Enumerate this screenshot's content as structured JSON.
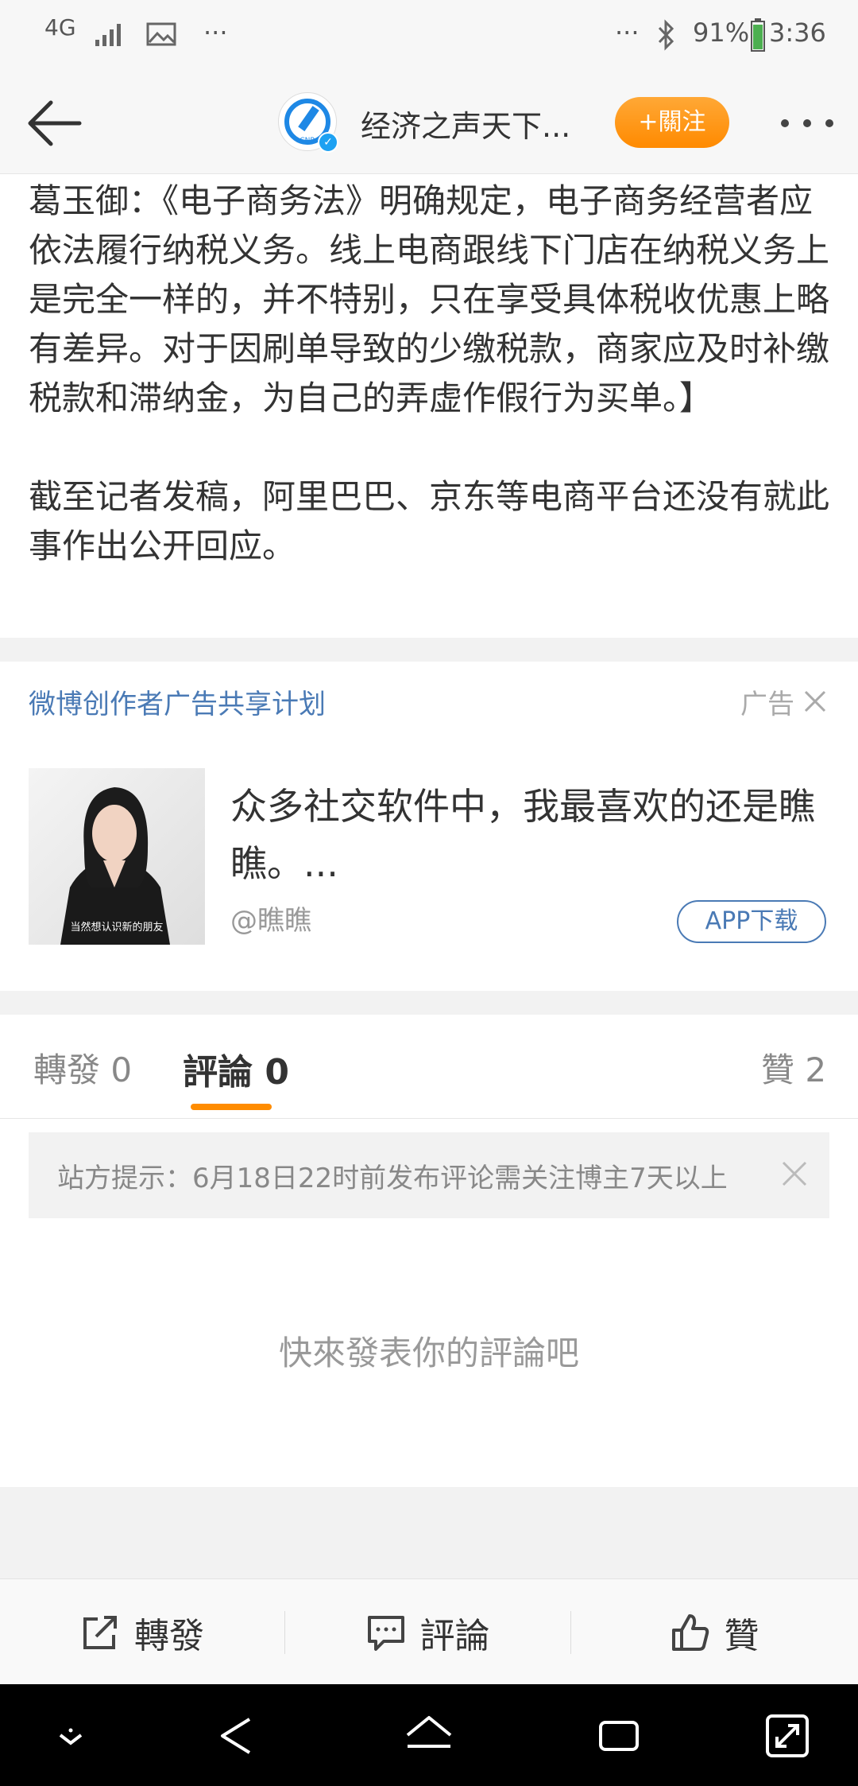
{
  "status_bar": {
    "network": "4G",
    "left_overflow": "···",
    "right_overflow": "···",
    "battery": "91%",
    "time": "3:36"
  },
  "header": {
    "title": "经济之声天下...",
    "follow_label": "+關注"
  },
  "article": {
    "paragraphs": [
      "葛玉御：《电子商务法》明确规定，电子商务经营者应依法履行纳税义务。线上电商跟线下门店在纳税义务上是完全一样的，并不特别，只在享受具体税收优惠上略有差异。对于因刷单导致的少缴税款，商家应及时补缴税款和滞纳金，为自己的弄虚作假行为买单。】",
      "截至记者发稿，阿里巴巴、京东等电商平台还没有就此事作出公开回应。"
    ]
  },
  "ad": {
    "source": "微博创作者广告共享计划",
    "label": "广告",
    "text": "众多社交软件中，我最喜欢的还是瞧瞧。...",
    "handle": "@瞧瞧",
    "button": "APP下载",
    "thumb_caption": "当然想认识新的朋友"
  },
  "tabs": {
    "repost": "轉發 0",
    "comment": "評論 0",
    "like": "贊 2"
  },
  "notice": {
    "text": "站方提示：6月18日22时前发布评论需关注博主7天以上"
  },
  "empty_hint": "快來發表你的評論吧",
  "actions": {
    "repost": "轉發",
    "comment": "評論",
    "like": "贊"
  },
  "colors": {
    "accent": "#ff8c00",
    "link": "#4a7ab5"
  },
  "icons": {
    "status": [
      "signal-icon",
      "image-icon",
      "bluetooth-icon",
      "battery-icon"
    ],
    "header": [
      "back-arrow-icon",
      "more-icon"
    ],
    "actions": [
      "repost-icon",
      "comment-icon",
      "thumbs-up-icon"
    ],
    "nav": [
      "hide-keyboard-icon",
      "back-icon",
      "home-icon",
      "recents-icon",
      "rotate-icon"
    ]
  }
}
